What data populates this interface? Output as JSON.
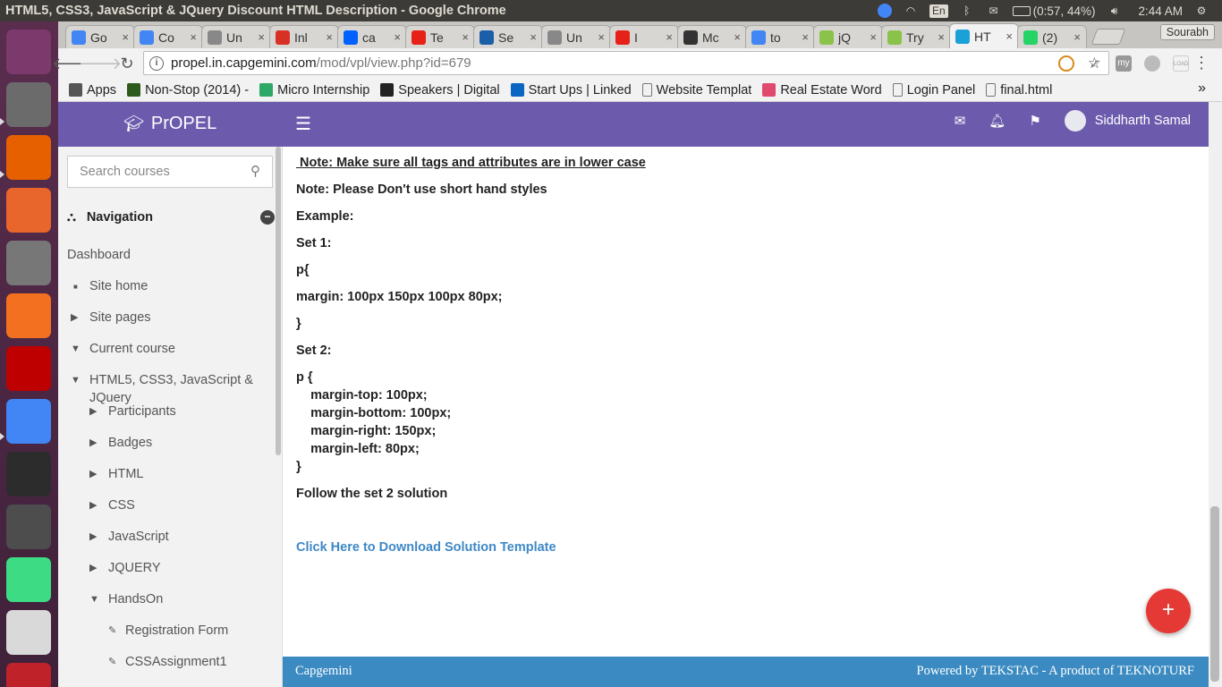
{
  "system": {
    "window_title": "HTML5, CSS3, JavaScript & JQuery Discount HTML Description - Google Chrome",
    "keyboard_lang": "En",
    "battery": "(0:57, 44%)",
    "time": "2:44 AM",
    "profile_name": "Sourabh"
  },
  "tabs": [
    {
      "label": "Go",
      "favicon": "google-icon",
      "color": "#4285f4"
    },
    {
      "label": "Co",
      "favicon": "google-icon",
      "color": "#4285f4"
    },
    {
      "label": "Un",
      "favicon": "page-icon",
      "color": "#888888"
    },
    {
      "label": "Inl",
      "favicon": "gmail-icon",
      "color": "#d93025"
    },
    {
      "label": "ca",
      "favicon": "dropbox-icon",
      "color": "#0061ff"
    },
    {
      "label": "Te",
      "favicon": "youtube-icon",
      "color": "#e62117"
    },
    {
      "label": "Se",
      "favicon": "sap-icon",
      "color": "#1a5fa8"
    },
    {
      "label": "Un",
      "favicon": "page-icon",
      "color": "#888888"
    },
    {
      "label": "I",
      "favicon": "youtube-icon",
      "color": "#e62117"
    },
    {
      "label": "Mc",
      "favicon": "square-icon",
      "color": "#333333"
    },
    {
      "label": "to",
      "favicon": "google-icon",
      "color": "#4285f4"
    },
    {
      "label": "jQ",
      "favicon": "w3-icon",
      "color": "#8bc34a"
    },
    {
      "label": "Try",
      "favicon": "w3-icon",
      "color": "#8bc34a"
    },
    {
      "label": "HT",
      "favicon": "cloud-icon",
      "color": "#1ba0d7",
      "active": true
    },
    {
      "label": "(2)",
      "favicon": "whatsapp-icon",
      "color": "#25d366"
    }
  ],
  "toolbar": {
    "url_host": "propel.in.capgemini.com",
    "url_path": "/mod/vpl/view.php?id=679"
  },
  "bookmarks": [
    {
      "label": "Apps",
      "icon": "apps-grid-icon",
      "color": "#555555"
    },
    {
      "label": "Non-Stop (2014) -",
      "icon": "movie-icon",
      "color": "#2d5a1d"
    },
    {
      "label": "Micro Internship",
      "icon": "microinternship-icon",
      "color": "#2ea866"
    },
    {
      "label": "Speakers | Digital",
      "icon": "ds-icon",
      "color": "#222222"
    },
    {
      "label": "Start Ups | Linked",
      "icon": "linkedin-icon",
      "color": "#0a66c2"
    },
    {
      "label": "Website Templat",
      "icon": "page-icon",
      "color": "#888888"
    },
    {
      "label": "Real Estate Word",
      "icon": "realestate-icon",
      "color": "#e04a6e"
    },
    {
      "label": "Login Panel",
      "icon": "page-icon",
      "color": "#888888"
    },
    {
      "label": "final.html",
      "icon": "page-icon",
      "color": "#888888"
    }
  ],
  "header": {
    "brand": "PrOPEL",
    "user": "Siddharth Samal"
  },
  "sidebar": {
    "search_placeholder": "Search courses",
    "nav_title": "Navigation",
    "items": [
      {
        "label": "Dashboard",
        "indent": 0,
        "marker": "none"
      },
      {
        "label": "Site home",
        "indent": 1,
        "marker": "bullet"
      },
      {
        "label": "Site pages",
        "indent": 1,
        "marker": "collapsed"
      },
      {
        "label": "Current course",
        "indent": 1,
        "marker": "expanded"
      },
      {
        "label": "HTML5, CSS3, JavaScript &",
        "label2": "JQuery",
        "indent": 2,
        "marker": "expanded"
      },
      {
        "label": "Participants",
        "indent": 3,
        "marker": "collapsed"
      },
      {
        "label": "Badges",
        "indent": 3,
        "marker": "collapsed"
      },
      {
        "label": "HTML",
        "indent": 3,
        "marker": "collapsed"
      },
      {
        "label": "CSS",
        "indent": 3,
        "marker": "collapsed"
      },
      {
        "label": "JavaScript",
        "indent": 3,
        "marker": "collapsed"
      },
      {
        "label": "JQUERY",
        "indent": 3,
        "marker": "collapsed"
      },
      {
        "label": "HandsOn",
        "indent": 3,
        "marker": "expanded"
      },
      {
        "label": "Registration Form",
        "indent": 4,
        "marker": "activity"
      },
      {
        "label": "CSSAssignment1",
        "indent": 4,
        "marker": "activity"
      }
    ]
  },
  "content": {
    "lines": [
      " Note: Make sure all tags and attributes are in lower case",
      "Note: Please Don't use short hand styles",
      "Example:",
      "Set 1:",
      "p{",
      "margin: 100px 150px 100px 80px;",
      "}",
      "Set 2:",
      "p {",
      "    margin-top: 100px;",
      "    margin-bottom: 100px;",
      "    margin-right: 150px;",
      "    margin-left: 80px;",
      "}",
      "Follow the set 2 solution"
    ],
    "download_link": "Click Here to Download Solution Template",
    "fab_symbol": "+"
  },
  "footer": {
    "left": "Capgemini",
    "right": "Powered by TEKSTAC - A product of TEKNOTURF"
  },
  "launcher": [
    {
      "name": "ubuntu-dash-icon",
      "color": "#7c3a6c"
    },
    {
      "name": "files-icon",
      "color": "#6b6b6b"
    },
    {
      "name": "firefox-icon",
      "color": "#e66000"
    },
    {
      "name": "software-center-icon",
      "color": "#e8662c"
    },
    {
      "name": "system-settings-icon",
      "color": "#777777"
    },
    {
      "name": "xampp-icon",
      "color": "#f37021"
    },
    {
      "name": "filezilla-icon",
      "color": "#bf0000"
    },
    {
      "name": "chrome-icon",
      "color": "#4285f4"
    },
    {
      "name": "terminal-icon",
      "color": "#2c2c2c"
    },
    {
      "name": "sublime-text-icon",
      "color": "#4d4d4d"
    },
    {
      "name": "android-studio-icon",
      "color": "#3ddc84"
    },
    {
      "name": "document-viewer-icon",
      "color": "#d9d9d9"
    },
    {
      "name": "lifebuoy-icon",
      "color": "#c0222a"
    }
  ]
}
